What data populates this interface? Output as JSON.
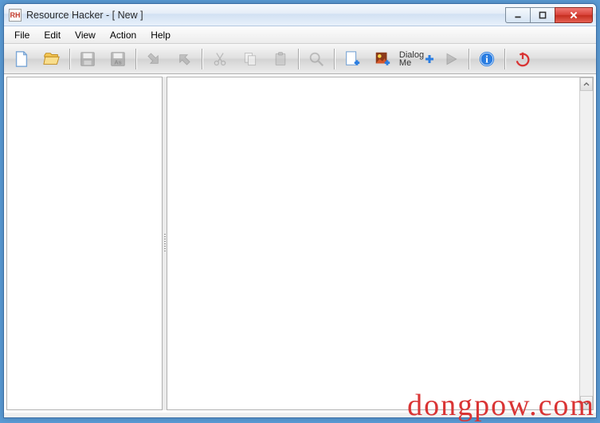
{
  "title": "Resource Hacker - [ New ]",
  "appicon_text": "RH",
  "menu": {
    "file": "File",
    "edit": "Edit",
    "view": "View",
    "action": "Action",
    "help": "Help"
  },
  "toolbar": {
    "new": "new-file",
    "open": "open-file",
    "save": "save",
    "saveas": "save-as",
    "import": "import",
    "export": "export",
    "cut": "cut",
    "copy": "copy",
    "paste": "paste",
    "find": "find",
    "addres": "add-resource",
    "addbin": "add-binary",
    "dialog": "dialog-menu",
    "dialog_label": "Dialog\nMe",
    "run": "run-script",
    "about": "about",
    "exit": "exit"
  },
  "watermark": "dongpow.com"
}
